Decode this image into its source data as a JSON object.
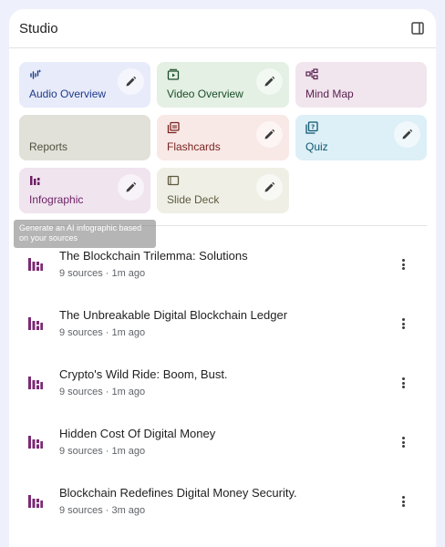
{
  "panel": {
    "title": "Studio"
  },
  "tiles": [
    {
      "label": "Audio Overview",
      "icon": "audio-wave-icon",
      "editable": true
    },
    {
      "label": "Video Overview",
      "icon": "video-icon",
      "editable": true
    },
    {
      "label": "Mind Map",
      "icon": "mind-map-icon",
      "editable": false
    },
    {
      "label": "Reports",
      "icon": "",
      "editable": false
    },
    {
      "label": "Flashcards",
      "icon": "flashcards-icon",
      "editable": true
    },
    {
      "label": "Quiz",
      "icon": "quiz-icon",
      "editable": true
    },
    {
      "label": "Infographic",
      "icon": "infographic-icon",
      "editable": true
    },
    {
      "label": "Slide Deck",
      "icon": "slide-deck-icon",
      "editable": true
    }
  ],
  "tooltip": {
    "text": "Generate an AI infographic based on your sources"
  },
  "items": [
    {
      "title": "The Blockchain Trilemma: Solutions",
      "meta": "9 sources · 1m ago"
    },
    {
      "title": "The Unbreakable Digital Blockchain Ledger",
      "meta": "9 sources · 1m ago"
    },
    {
      "title": "Crypto's Wild Ride: Boom, Bust.",
      "meta": "9 sources · 1m ago"
    },
    {
      "title": "Hidden Cost Of Digital Money",
      "meta": "9 sources · 1m ago"
    },
    {
      "title": "Blockchain Redefines Digital Money Security.",
      "meta": "9 sources · 3m ago"
    }
  ],
  "colors": {
    "accent_infographic": "#7b2a74",
    "background": "#eef0fb"
  }
}
